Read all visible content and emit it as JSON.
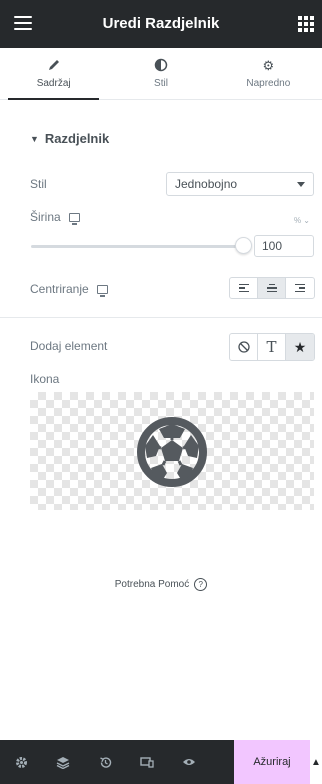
{
  "header": {
    "title": "Uredi Razdjelnik",
    "menu_icon": "hamburger-icon",
    "apps_icon": "grid-icon"
  },
  "tabs": [
    {
      "label": "Sadržaj",
      "icon": "pencil-icon",
      "active": true
    },
    {
      "label": "Stil",
      "icon": "half-circle-icon",
      "active": false
    },
    {
      "label": "Napredno",
      "icon": "gear-icon",
      "active": false
    }
  ],
  "section": {
    "title": "Razdjelnik"
  },
  "controls": {
    "style": {
      "label": "Stil",
      "value": "Jednobojno"
    },
    "width": {
      "label": "Širina",
      "unit": "%",
      "value": "100",
      "fraction": 1.0
    },
    "align": {
      "label": "Centriranje",
      "selected": "center"
    },
    "element": {
      "label": "Dodaj element",
      "selected": "icon"
    },
    "icon": {
      "label": "Ikona",
      "icon_name": "soccer-ball-icon"
    }
  },
  "help": {
    "label": "Potrebna Pomoć",
    "icon": "question-circle-icon"
  },
  "footer": {
    "icons": [
      "settings-icon",
      "layers-icon",
      "history-icon",
      "responsive-icon",
      "eye-icon"
    ],
    "update_label": "Ažuriraj",
    "more_icon": "chevron-up-icon"
  },
  "colors": {
    "header_bg": "#26292c",
    "text": "#6d7882",
    "accent": "#f2c6ff",
    "border": "#d5dadf",
    "icon_fill": "#495157"
  }
}
